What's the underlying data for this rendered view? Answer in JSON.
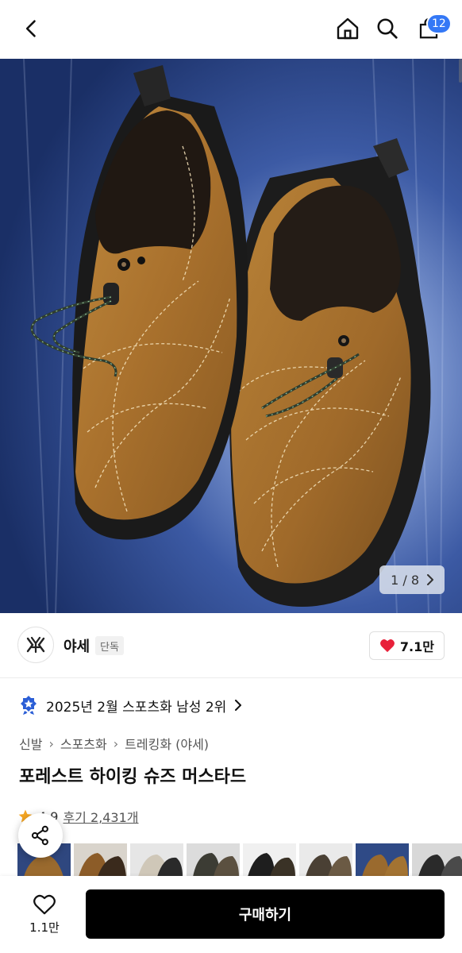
{
  "header": {
    "back_icon": "chevron-left-icon",
    "home_icon": "home-icon",
    "search_icon": "search-icon",
    "bag_icon": "shopping-bag-icon",
    "cart_count": "12"
  },
  "gallery": {
    "current": "1",
    "total": "8",
    "pager_text": "1 / 8",
    "next_icon": "chevron-right-icon"
  },
  "brand": {
    "name": "야세",
    "tag": "단독",
    "like_count": "7.1만",
    "like_icon": "heart-filled-icon",
    "like_color": "#e8203a"
  },
  "ranking": {
    "text": "2025년 2월 스포츠화 남성 2위",
    "icon": "medal-star-icon",
    "icon_color": "#2c5fd6"
  },
  "breadcrumb": [
    "신발",
    "스포츠화",
    "트레킹화 (야세)"
  ],
  "product": {
    "title": "포레스트 하이킹 슈즈 머스타드",
    "rating": "4.9",
    "reviews": "후기 2,431개",
    "star_color": "#f5a623"
  },
  "bottom": {
    "wish_count": "1.1만",
    "buy_label": "구매하기"
  },
  "colors": {
    "accent": "#3478f6",
    "buy_bg": "#000000"
  }
}
